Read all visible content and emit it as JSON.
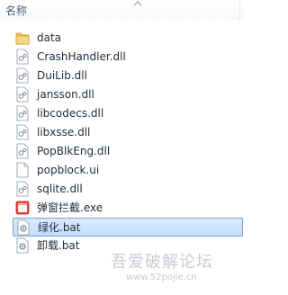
{
  "header": {
    "name_label": "名称"
  },
  "files": [
    {
      "label": "data",
      "icon": "folder-icon"
    },
    {
      "label": "CrashHandler.dll",
      "icon": "dll-file-icon"
    },
    {
      "label": "DuiLib.dll",
      "icon": "dll-file-icon"
    },
    {
      "label": "jansson.dll",
      "icon": "dll-file-icon"
    },
    {
      "label": "libcodecs.dll",
      "icon": "dll-file-icon"
    },
    {
      "label": "libxsse.dll",
      "icon": "dll-file-icon"
    },
    {
      "label": "PopBlkEng.dll",
      "icon": "dll-file-icon"
    },
    {
      "label": "popblock.ui",
      "icon": "blank-file-icon"
    },
    {
      "label": "sqlite.dll",
      "icon": "dll-file-icon"
    },
    {
      "label": "弹窗拦截.exe",
      "icon": "exe-app-icon"
    },
    {
      "label": "绿化.bat",
      "icon": "bat-file-icon",
      "selected": true
    },
    {
      "label": "卸载.bat",
      "icon": "bat-file-icon"
    }
  ],
  "watermark": {
    "text": "吾爱破解论坛",
    "url": "www.52pojie.cn"
  },
  "colors": {
    "selection": "#c8e0fc",
    "folder": "#e8c35a",
    "text": "#1e2b3a"
  }
}
